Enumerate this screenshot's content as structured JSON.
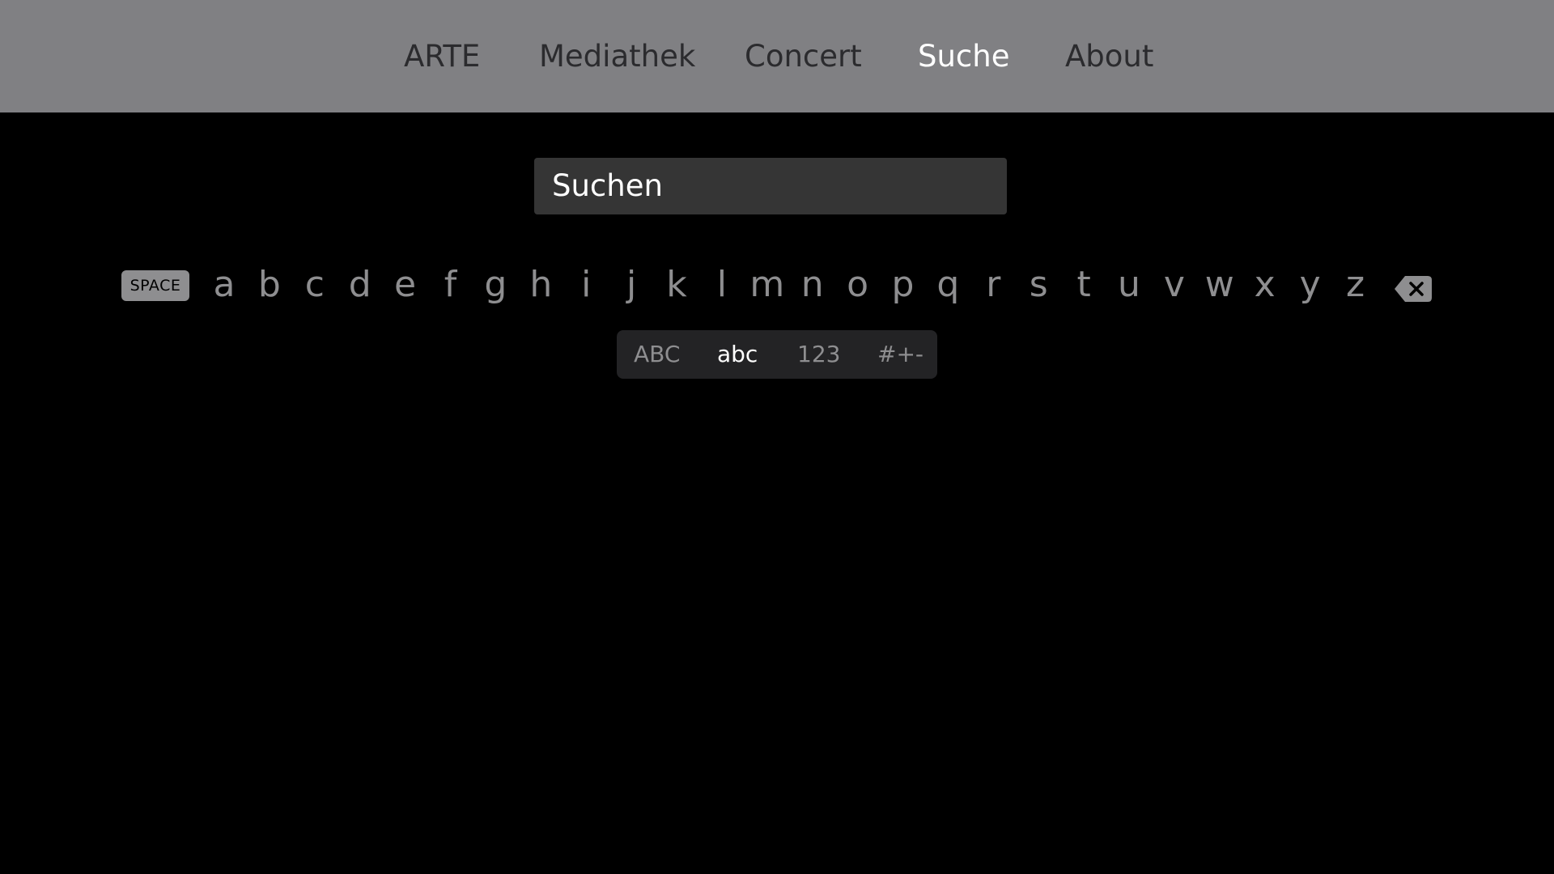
{
  "nav": {
    "tabs": [
      {
        "label": "ARTE"
      },
      {
        "label": "Mediathek"
      },
      {
        "label": "Concert"
      },
      {
        "label": "Suche",
        "active": true
      },
      {
        "label": "About"
      }
    ]
  },
  "search": {
    "placeholder": "Suchen",
    "value": ""
  },
  "keyboard": {
    "space_label": "SPACE",
    "letters": [
      "a",
      "b",
      "c",
      "d",
      "e",
      "f",
      "g",
      "h",
      "i",
      "j",
      "k",
      "l",
      "m",
      "n",
      "o",
      "p",
      "q",
      "r",
      "s",
      "t",
      "u",
      "v",
      "w",
      "x",
      "y",
      "z"
    ],
    "delete_icon": "delete-backspace-icon",
    "modes": [
      {
        "label": "ABC"
      },
      {
        "label": "abc",
        "active": true
      },
      {
        "label": "123"
      },
      {
        "label": "#+-"
      }
    ]
  },
  "colors": {
    "topbar_bg": "#808083",
    "nav_inactive": "#2b2b2e",
    "nav_active": "#ffffff",
    "background": "#000000",
    "search_bg": "#353535",
    "key_gray": "#8e8e90",
    "mode_bg": "#232325"
  }
}
